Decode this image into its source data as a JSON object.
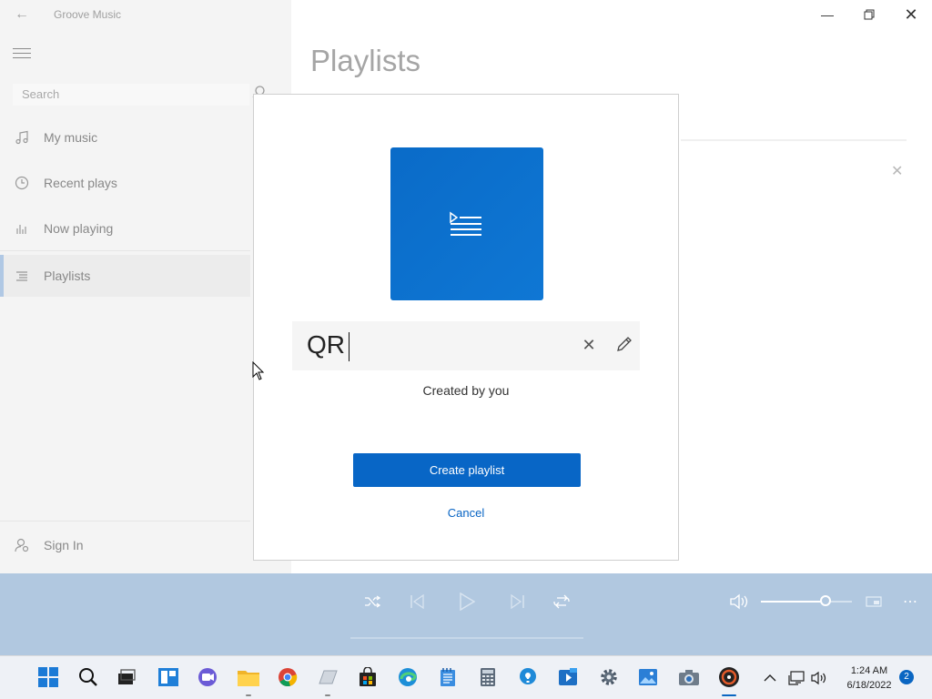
{
  "app": {
    "title": "Groove Music"
  },
  "sidebar": {
    "search_placeholder": "Search",
    "items": [
      {
        "label": "My music",
        "icon": "music-note-icon"
      },
      {
        "label": "Recent plays",
        "icon": "clock-icon"
      },
      {
        "label": "Now playing",
        "icon": "bars-icon"
      },
      {
        "label": "Playlists",
        "icon": "playlist-icon",
        "active": true
      }
    ],
    "sign_in": "Sign In"
  },
  "main": {
    "title": "Playlists"
  },
  "dialog": {
    "name_value": "QR",
    "subtitle": "Created by you",
    "create_label": "Create playlist",
    "cancel_label": "Cancel"
  },
  "player": {
    "volume_level": 0.73
  },
  "taskbar": {
    "time": "1:24 AM",
    "date": "6/18/2022",
    "notification_count": "2"
  },
  "colors": {
    "accent": "#0866c6",
    "player_bar": "#b1c8e0",
    "album_art": "#0a6bc8"
  }
}
